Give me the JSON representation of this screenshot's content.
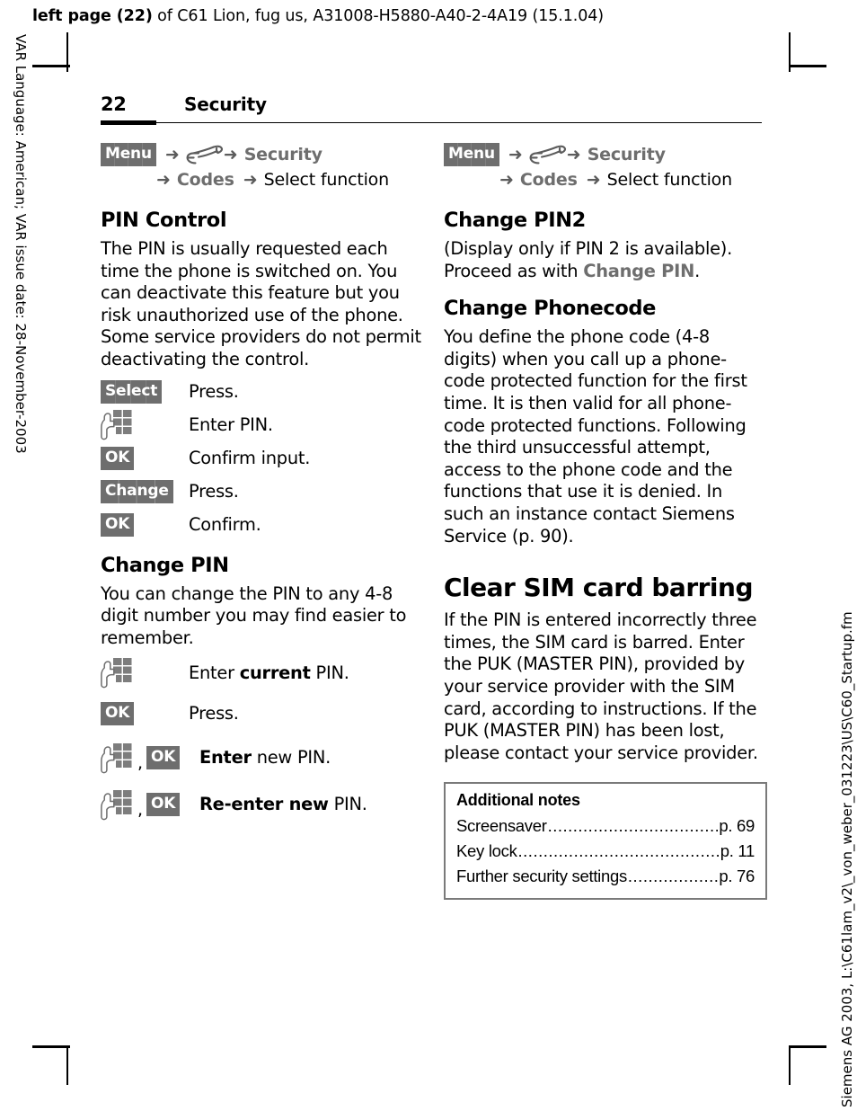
{
  "running_head": {
    "bold_part": "left page (22)",
    "rest": " of C61 Lion, fug us, A31008-H5880-A40-2-4A19 (15.1.04)"
  },
  "side_notes": {
    "left": "VAR Language: American; VAR issue date: 28-November-2003",
    "right": "Siemens AG 2003, L:\\C61lam_v2\\_von_weber_031223\\US\\C60_Startup.fm"
  },
  "header": {
    "page_number": "22",
    "chapter": "Security"
  },
  "colors": {
    "badge_grey": "#6e6e6e",
    "nav_grey": "#6e6e6e",
    "note_border": "#7a7a7a",
    "text_black": "#000000"
  },
  "left_column": {
    "nav": {
      "menu_label": "Menu",
      "arrow": "➜",
      "icon_name": "wrench-icon",
      "step_security": "Security",
      "step_codes": "Codes",
      "step_select": "Select function"
    },
    "section_pin_control": {
      "heading": "PIN Control",
      "body": "The PIN is usually requested each time the phone is switched on. You can deactivate this feature but you risk unauthorized use of the phone. Some service providers do not permit deactivating the control.",
      "steps": [
        {
          "key_type": "badge",
          "key_label": "Select",
          "desc": "Press."
        },
        {
          "key_type": "keypad",
          "key_label": "",
          "desc": "Enter PIN."
        },
        {
          "key_type": "badge",
          "key_label": "OK",
          "desc": "Confirm input."
        },
        {
          "key_type": "badge",
          "key_label": "Change",
          "desc": "Press."
        },
        {
          "key_type": "badge",
          "key_label": "OK",
          "desc": "Confirm."
        }
      ]
    },
    "section_change_pin": {
      "heading": "Change PIN",
      "body": "You can change the PIN to any 4-8 digit number you may find easier to remember.",
      "steps": [
        {
          "key_type": "keypad",
          "key_label": "",
          "desc_bold": "current",
          "desc_pre": "Enter ",
          "desc_post": " PIN."
        },
        {
          "key_type": "badge",
          "key_label": "OK",
          "desc_pre": "Press.",
          "desc_bold": "",
          "desc_post": ""
        },
        {
          "key_type": "keypad+badge",
          "key_label": "OK",
          "desc_pre": "",
          "desc_bold": "Enter",
          "desc_post": " new PIN."
        },
        {
          "key_type": "keypad+badge",
          "key_label": "OK",
          "desc_pre": "",
          "desc_bold": "Re-enter new",
          "desc_post": " PIN."
        }
      ]
    }
  },
  "right_column": {
    "nav": {
      "menu_label": "Menu",
      "arrow": "➜",
      "icon_name": "wrench-icon",
      "step_security": "Security",
      "step_codes": "Codes",
      "step_select": "Select function"
    },
    "section_change_pin2": {
      "heading": "Change PIN2",
      "body_pre": "(Display only if PIN 2 is available). Proceed as with ",
      "body_grey": "Change PIN",
      "body_post": "."
    },
    "section_change_phonecode": {
      "heading": "Change Phonecode",
      "body": "You define the phone code (4-8 digits) when you call up a phone-code protected function for the first time. It is then valid for all phone-code protected functions. Following the third unsuccessful attempt, access to the phone code and the functions that use it is denied. In such an instance contact Siemens Service (p. 90)."
    },
    "section_clear_sim": {
      "heading": "Clear SIM card barring",
      "body": "If the PIN is entered incorrectly three times, the SIM card is barred. Enter the PUK (MASTER PIN), provided by your service provider with the SIM card, according to instructions. If the PUK (MASTER PIN) has been lost, please contact your service provider."
    },
    "additional_notes": {
      "title": "Additional notes",
      "rows": [
        {
          "label": "Screensaver",
          "page": "p. 69"
        },
        {
          "label": "Key lock",
          "page": "p. 11"
        },
        {
          "label": "Further security settings",
          "page": "p. 76"
        }
      ]
    }
  }
}
